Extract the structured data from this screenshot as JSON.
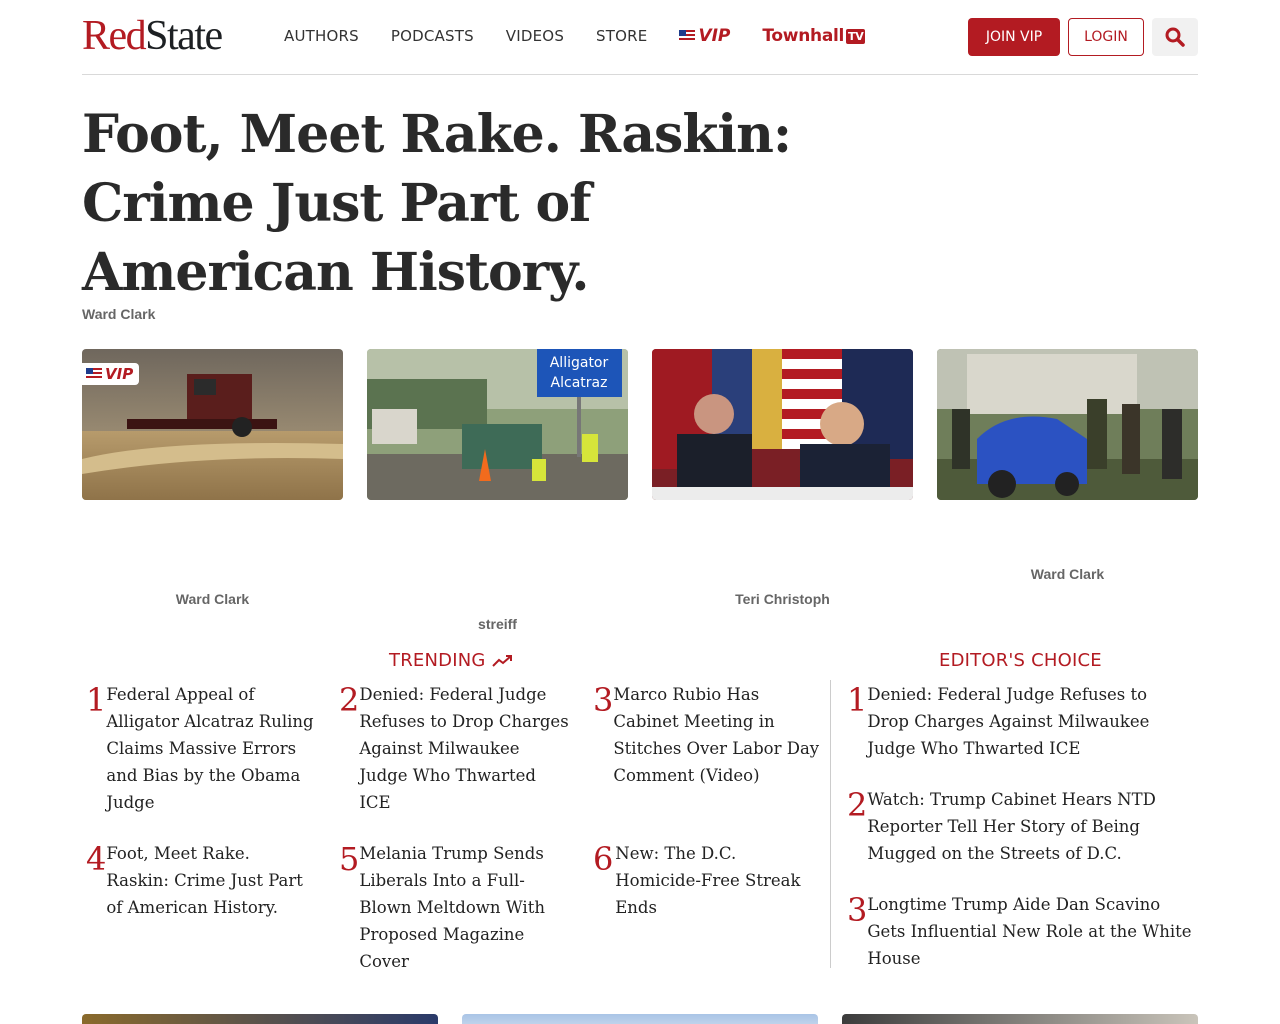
{
  "header": {
    "logo_red": "Red",
    "logo_dark": "State",
    "nav": [
      "AUTHORS",
      "PODCASTS",
      "VIDEOS",
      "STORE"
    ],
    "vip_label": "VIP",
    "townhall_label": "Townhall",
    "townhall_tv": "TV",
    "join_label": "JOIN VIP",
    "login_label": "LOGIN"
  },
  "article": {
    "title": "Foot, Meet Rake. Raskin: Crime Just Part of American History.",
    "author": "Ward Clark"
  },
  "cards": [
    {
      "author": "Ward Clark",
      "vip": true,
      "vip_label": "VIP",
      "sign_line1": "",
      "sign_line2": ""
    },
    {
      "author": "streiff",
      "vip": false,
      "sign_line1": "Alligator",
      "sign_line2": "Alcatraz"
    },
    {
      "author": "Teri Christoph",
      "vip": false
    },
    {
      "author": "Ward Clark",
      "vip": false
    }
  ],
  "trending": {
    "title": "TRENDING",
    "items": [
      {
        "num": "1",
        "text": "Federal Appeal of Alligator Alcatraz Ruling Claims Massive Errors and Bias by the Obama Judge"
      },
      {
        "num": "2",
        "text": "Denied: Federal Judge Refuses to Drop Charges Against Milwaukee Judge Who Thwarted ICE"
      },
      {
        "num": "3",
        "text": "Marco Rubio Has Cabinet Meeting in Stitches Over Labor Day Comment (Video)"
      },
      {
        "num": "4",
        "text": "Foot, Meet Rake. Raskin: Crime Just Part of American History."
      },
      {
        "num": "5",
        "text": "Melania Trump Sends Liberals Into a Full-Blown Meltdown With Proposed Magazine Cover"
      },
      {
        "num": "6",
        "text": "New: The D.C. Homicide-Free Streak Ends"
      }
    ]
  },
  "editors": {
    "title": "EDITOR'S CHOICE",
    "items": [
      {
        "num": "1",
        "text": "Denied: Federal Judge Refuses to Drop Charges Against Milwaukee Judge Who Thwarted ICE"
      },
      {
        "num": "2",
        "text": "Watch: Trump Cabinet Hears NTD Reporter Tell Her Story of Being Mugged on the Streets of D.C."
      },
      {
        "num": "3",
        "text": "Longtime Trump Aide Dan Scavino Gets Influential New Role at the White House"
      }
    ]
  },
  "colors": {
    "brand_red": "#b31b22",
    "text_dark": "#222222",
    "meta_gray": "#666666"
  }
}
